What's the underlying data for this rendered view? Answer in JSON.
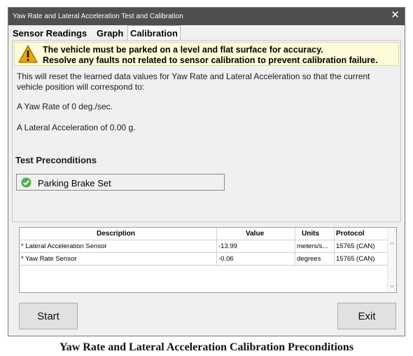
{
  "window": {
    "title": "Yaw Rate and Lateral Acceleration Test and Calibration",
    "close_glyph": "✕"
  },
  "tabs": [
    {
      "label": "Sensor Readings",
      "active": false
    },
    {
      "label": "Graph",
      "active": false
    },
    {
      "label": "Calibration",
      "active": true
    }
  ],
  "warning": {
    "icon": "warning-triangle-icon",
    "line1": "The vehicle must be parked on a level and flat surface for accuracy.",
    "line2": "Resolve any faults not related to sensor calibration to prevent calibration failure."
  },
  "info": {
    "line1": "This will reset the learned data values for Yaw Rate and Lateral Acceleration so  that the current",
    "line2": "vehicle position will correspond to:",
    "yaw": "A Yaw Rate of 0 deg./sec.",
    "lateral": "A Lateral Acceleration of 0.00 g."
  },
  "preconditions": {
    "heading": "Test Preconditions",
    "items": [
      {
        "label": "Parking Brake Set",
        "status": "ok",
        "icon": "green-check-icon"
      }
    ]
  },
  "table": {
    "columns": [
      "Description",
      "Value",
      "Units",
      "Protocol"
    ],
    "rows": [
      {
        "description": "* Lateral Acceleration Sensor",
        "value": "-13.99",
        "units": "meters/s...",
        "protocol": "15765 (CAN)"
      },
      {
        "description": "* Yaw Rate Sensor",
        "value": "-0.06",
        "units": "degrees",
        "protocol": "15765 (CAN)"
      }
    ]
  },
  "buttons": {
    "start": "Start",
    "exit": "Exit"
  },
  "caption": "Yaw Rate and Lateral Acceleration Calibration Preconditions",
  "colors": {
    "titlebar": "#4f4f4f",
    "warning_bg": "#fffbd9",
    "check": "#4caf50",
    "warning_icon": "#f0a400"
  }
}
